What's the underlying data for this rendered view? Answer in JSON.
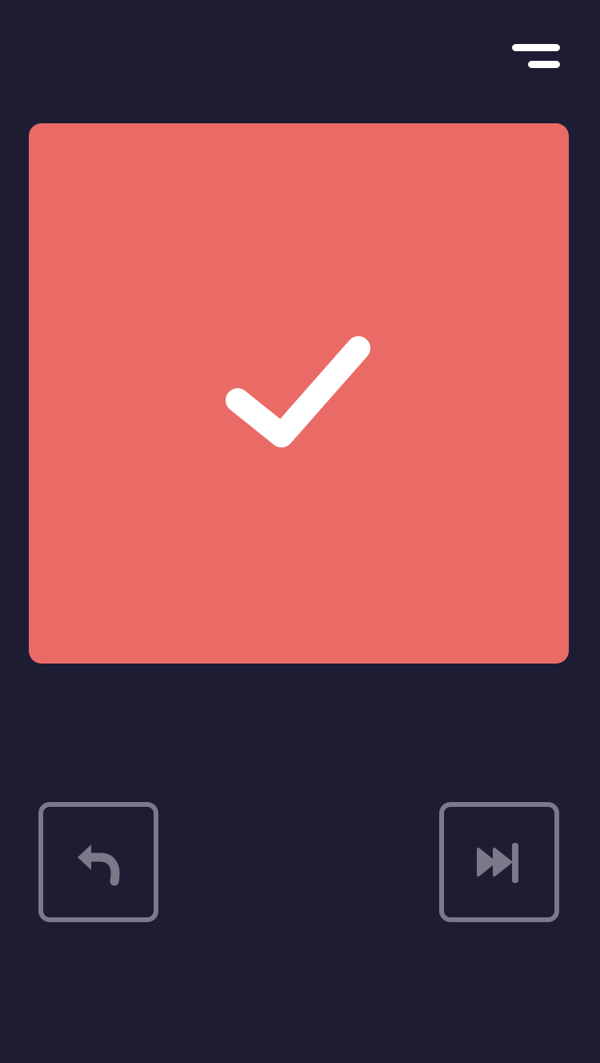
{
  "colors": {
    "background": "#1d1c33",
    "card": "#ea6b66",
    "icon_fg": "#ffffff",
    "button_outline": "#7a798a"
  },
  "header": {
    "menu_icon": "hamburger-menu-icon"
  },
  "card": {
    "state": "correct",
    "icon": "checkmark-icon"
  },
  "controls": {
    "undo": {
      "icon": "undo-arrow-icon"
    },
    "skip": {
      "icon": "skip-forward-icon"
    }
  }
}
